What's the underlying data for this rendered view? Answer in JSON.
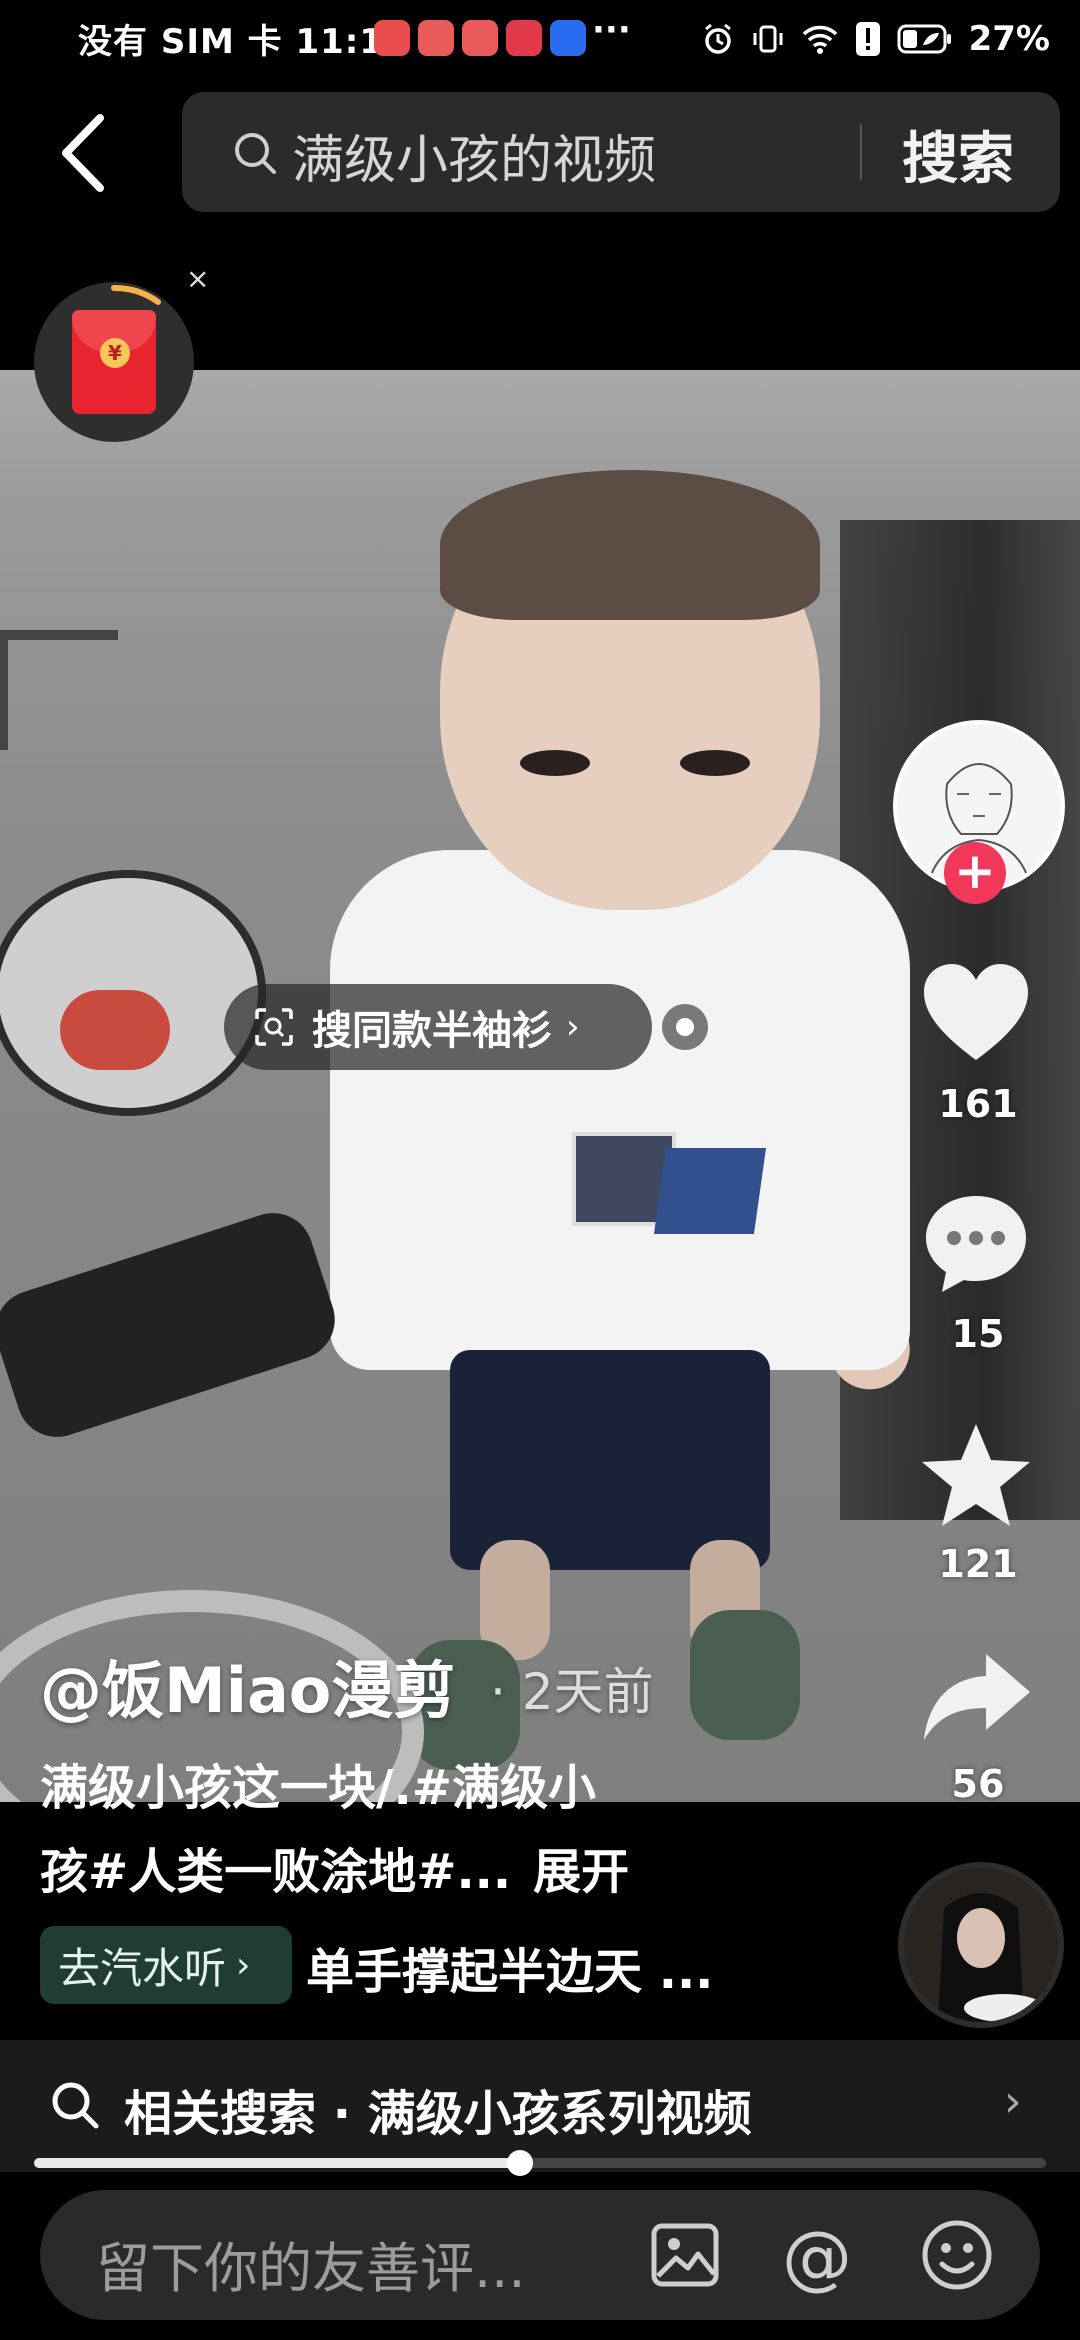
{
  "status_bar": {
    "left_text": "没有 SIM 卡 11:10",
    "more": "···",
    "battery": "27%"
  },
  "header": {
    "search_query": "满级小孩的视频",
    "search_button": "搜索"
  },
  "video": {
    "product_tag": "搜同款半袖衫",
    "author": "@饭Miao漫剪",
    "time": "· 2天前",
    "caption_line1": "满级小孩这一块/.#满级小",
    "caption_line2": "孩#人类一败涂地#...",
    "caption_expand": "展开"
  },
  "rail": {
    "like_count": "161",
    "comment_count": "15",
    "favorite_count": "121",
    "share_count": "56"
  },
  "music": {
    "chip_label": "去汽水听",
    "chip_chevron": "›",
    "title": "单手撑起半边天 ..."
  },
  "related": {
    "text": "相关搜索 · 满级小孩系列视频",
    "chevron": "›"
  },
  "progress": {
    "fraction": 0.48
  },
  "comment_bar": {
    "placeholder": "留下你的友善评..."
  },
  "colors": {
    "follow": "#f2385a",
    "music_chip": "#1f3c35",
    "red_packet": "#e8252f"
  },
  "icons": [
    "back-icon",
    "search-icon",
    "alarm-icon",
    "vibrate-icon",
    "wifi-icon",
    "battery-icon",
    "red-packet-icon",
    "heart-icon",
    "comment-icon",
    "star-icon",
    "share-icon",
    "image-icon",
    "at-icon",
    "emoji-icon",
    "scan-icon"
  ]
}
